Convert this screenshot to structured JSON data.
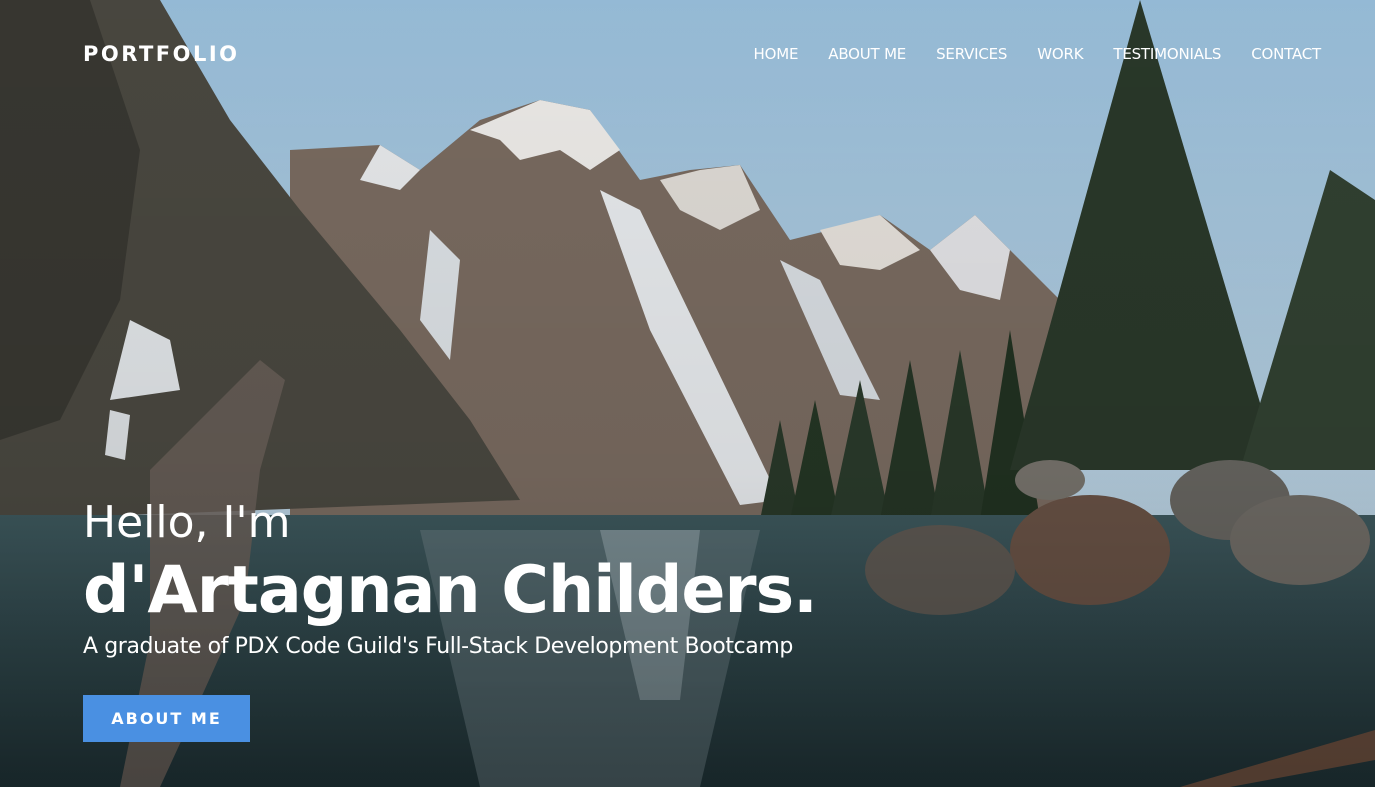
{
  "header": {
    "brand": "PORTFOLIO",
    "nav": [
      "HOME",
      "ABOUT ME",
      "SERVICES",
      "WORK",
      "TESTIMONIALS",
      "CONTACT"
    ]
  },
  "hero": {
    "greeting": "Hello, I'm",
    "name": "d'Artagnan Childers.",
    "tagline": "A graduate of PDX Code Guild's Full-Stack Development Bootcamp",
    "cta_label": "ABOUT ME",
    "background": "mountain-lake-photo"
  },
  "colors": {
    "accent": "#4a90e2",
    "text": "#ffffff"
  }
}
